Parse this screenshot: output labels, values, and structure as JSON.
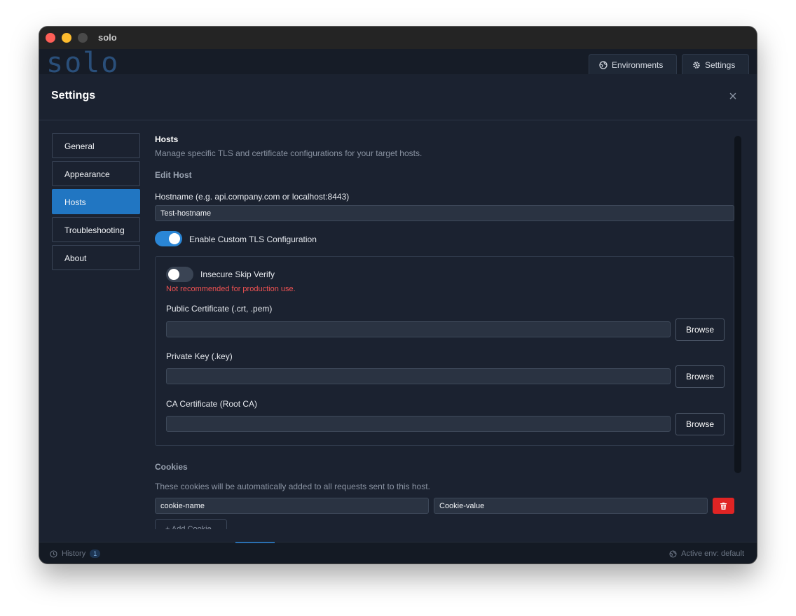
{
  "window": {
    "title": "solo"
  },
  "app": {
    "logo_text": "solo",
    "environments_label": "Environments",
    "settings_label": "Settings"
  },
  "modal": {
    "title": "Settings",
    "close_icon": "×"
  },
  "nav": {
    "items": [
      {
        "label": "General"
      },
      {
        "label": "Appearance"
      },
      {
        "label": "Hosts"
      },
      {
        "label": "Troubleshooting"
      },
      {
        "label": "About"
      }
    ],
    "active": "Hosts"
  },
  "hosts": {
    "title": "Hosts",
    "description": "Manage specific TLS and certificate configurations for your target hosts.",
    "edit_heading": "Edit Host",
    "hostname_label": "Hostname (e.g. api.company.com or localhost:8443)",
    "hostname_value": "Test-hostname",
    "custom_tls_label": "Enable Custom TLS Configuration",
    "custom_tls_enabled": true,
    "tls": {
      "insecure_label": "Insecure Skip Verify",
      "insecure_enabled": false,
      "insecure_warning": "Not recommended for production use.",
      "public_cert_label": "Public Certificate (.crt, .pem)",
      "public_cert_value": "",
      "private_key_label": "Private Key (.key)",
      "private_key_value": "",
      "ca_cert_label": "CA Certificate (Root CA)",
      "ca_cert_value": "",
      "browse_label": "Browse"
    },
    "cookies": {
      "heading": "Cookies",
      "description": "These cookies will be automatically added to all requests sent to this host.",
      "name_value": "cookie-name",
      "value_value": "Cookie-value",
      "add_label": "+ Add Cookie"
    }
  },
  "status": {
    "history_label": "History",
    "history_count": "1",
    "active_env": "Active env: default"
  },
  "colors": {
    "accent": "#2176c2",
    "danger": "#e02424",
    "background": "#1b2230"
  }
}
